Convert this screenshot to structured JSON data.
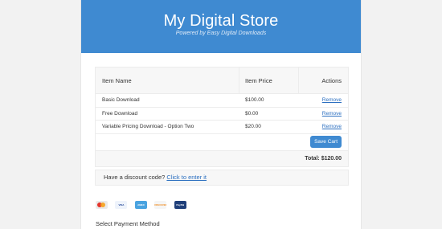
{
  "header": {
    "title": "My Digital Store",
    "tagline": "Powered by Easy Digital Downloads"
  },
  "cart": {
    "columns": {
      "name": "Item Name",
      "price": "Item Price",
      "actions": "Actions"
    },
    "items": [
      {
        "name": "Basic Download",
        "price": "$100.00",
        "action": "Remove"
      },
      {
        "name": "Free Download",
        "price": "$0.00",
        "action": "Remove"
      },
      {
        "name": "Variable Pricing Download - Option Two",
        "price": "$20.00",
        "action": "Remove"
      }
    ],
    "save_label": "Save Cart",
    "total": "Total: $120.00"
  },
  "discount": {
    "prompt": "Have a discount code?",
    "link": "Click to enter it"
  },
  "payment": {
    "icons": [
      "mastercard-icon",
      "visa-icon",
      "amex-icon",
      "discover-icon",
      "paypal-icon"
    ],
    "icon_labels": {
      "visa": "VISA",
      "amex": "AMEX",
      "discover": "DISCOVER",
      "paypal": "PayPal"
    },
    "title": "Select Payment Method"
  },
  "colors": {
    "header_bg": "#3f8ad1",
    "link": "#2b6fc0",
    "button_bg": "#3f8ad1"
  }
}
